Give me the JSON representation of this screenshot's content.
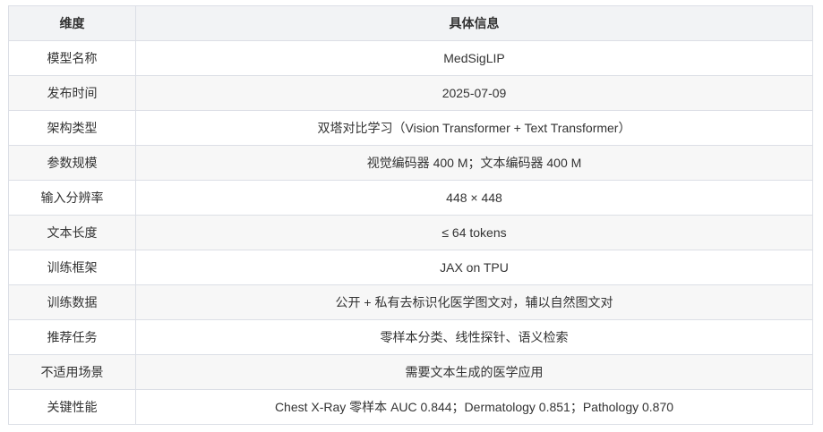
{
  "table": {
    "headers": [
      "维度",
      "具体信息"
    ],
    "rows": [
      {
        "dimension": "模型名称",
        "info": "MedSigLIP"
      },
      {
        "dimension": "发布时间",
        "info": "2025-07-09"
      },
      {
        "dimension": "架构类型",
        "info": "双塔对比学习（Vision Transformer + Text Transformer）"
      },
      {
        "dimension": "参数规模",
        "info": "视觉编码器 400 M；文本编码器 400 M"
      },
      {
        "dimension": "输入分辨率",
        "info": "448 × 448"
      },
      {
        "dimension": "文本长度",
        "info": "≤ 64 tokens"
      },
      {
        "dimension": "训练框架",
        "info": "JAX on TPU"
      },
      {
        "dimension": "训练数据",
        "info": "公开 + 私有去标识化医学图文对，辅以自然图文对"
      },
      {
        "dimension": "推荐任务",
        "info": "零样本分类、线性探针、语义检索"
      },
      {
        "dimension": "不适用场景",
        "info": "需要文本生成的医学应用"
      },
      {
        "dimension": "关键性能",
        "info": "Chest X-Ray 零样本 AUC 0.844；Dermatology 0.851；Pathology 0.870"
      }
    ]
  }
}
